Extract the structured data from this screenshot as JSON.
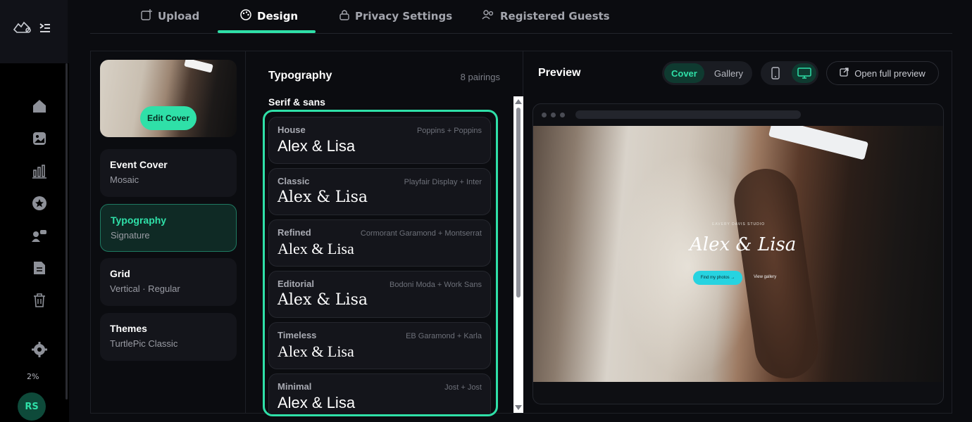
{
  "nav": {
    "tabs": [
      {
        "label": "Upload",
        "icon": "upload-image-icon"
      },
      {
        "label": "Design",
        "icon": "palette-icon"
      },
      {
        "label": "Privacy Settings",
        "icon": "lock-icon"
      },
      {
        "label": "Registered Guests",
        "icon": "guests-icon"
      }
    ],
    "active_tab": "Design"
  },
  "rail": {
    "items": [
      "home-icon",
      "image-icon",
      "bar-chart-icon",
      "star-icon",
      "users-icon",
      "document-icon",
      "trash-icon"
    ],
    "settings_icon": "gear-icon",
    "usage_label": "2%",
    "avatar_initials": "RS"
  },
  "sidebar": {
    "edit_cover_label": "Edit Cover",
    "items": [
      {
        "title": "Event Cover",
        "value": "Mosaic"
      },
      {
        "title": "Typography",
        "value": "Signature",
        "active": true
      },
      {
        "title": "Grid",
        "value": "Vertical · Regular"
      },
      {
        "title": "Themes",
        "value": "TurtlePic Classic"
      }
    ]
  },
  "typography": {
    "title": "Typography",
    "count_label": "8 pairings",
    "group_label": "Serif & sans",
    "pairings": [
      {
        "name": "House",
        "fonts": "Poppins + Poppins",
        "sample": "Alex & Lisa"
      },
      {
        "name": "Classic",
        "fonts": "Playfair Display + Inter",
        "sample": "Alex & Lisa"
      },
      {
        "name": "Refined",
        "fonts": "Cormorant Garamond + Montserrat",
        "sample": "Alex & Lisa"
      },
      {
        "name": "Editorial",
        "fonts": "Bodoni Moda + Work Sans",
        "sample": "Alex & Lisa"
      },
      {
        "name": "Timeless",
        "fonts": "EB Garamond + Karla",
        "sample": "Alex & Lisa"
      },
      {
        "name": "Minimal",
        "fonts": "Jost + Jost",
        "sample": "Alex & Lisa"
      }
    ]
  },
  "preview": {
    "title": "Preview",
    "view_options": [
      "Cover",
      "Gallery"
    ],
    "active_view": "Cover",
    "devices": [
      "mobile-icon",
      "desktop-icon"
    ],
    "active_device": "desktop-icon",
    "open_full_label": "Open full preview",
    "hero": {
      "studio": "EAVERY DAVIS STUDIO",
      "names": "Alex & Lisa",
      "primary_button": "Find my photos →",
      "secondary_link": "View gallery"
    }
  },
  "colors": {
    "accent": "#2fe0a8",
    "background": "#0b0c10",
    "panel": "#14151b"
  }
}
